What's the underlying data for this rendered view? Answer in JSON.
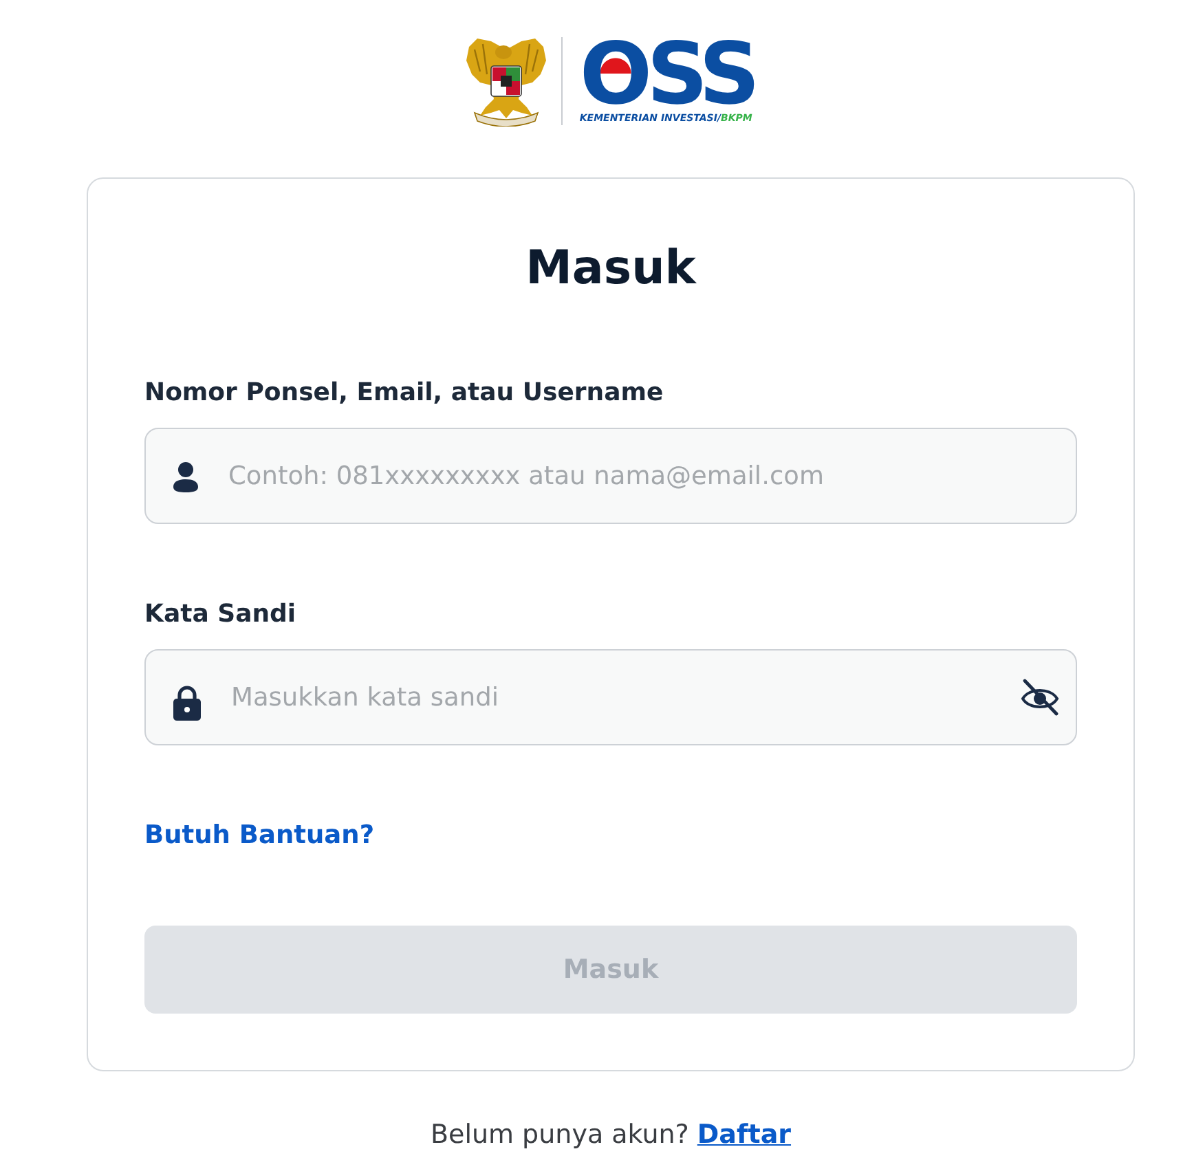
{
  "header": {
    "logo_text": "OSS",
    "tagline": "KEMENTERIAN INVESTASI/",
    "tagline_accent": "BKPM"
  },
  "form": {
    "title": "Masuk",
    "fields": [
      {
        "kind": "text",
        "label": "Nomor Ponsel, Email, atau Username",
        "placeholder": "Contoh: 081xxxxxxxxx atau nama@email.com"
      },
      {
        "kind": "password",
        "label": "Kata Sandi",
        "placeholder": "Masukkan kata sandi",
        "password_visible": false
      }
    ],
    "help_link": "Butuh Bantuan?",
    "submit": {
      "label": "Masuk",
      "disabled": true
    }
  },
  "footer": {
    "prompt": "Belum punya akun?",
    "link": "Daftar"
  }
}
